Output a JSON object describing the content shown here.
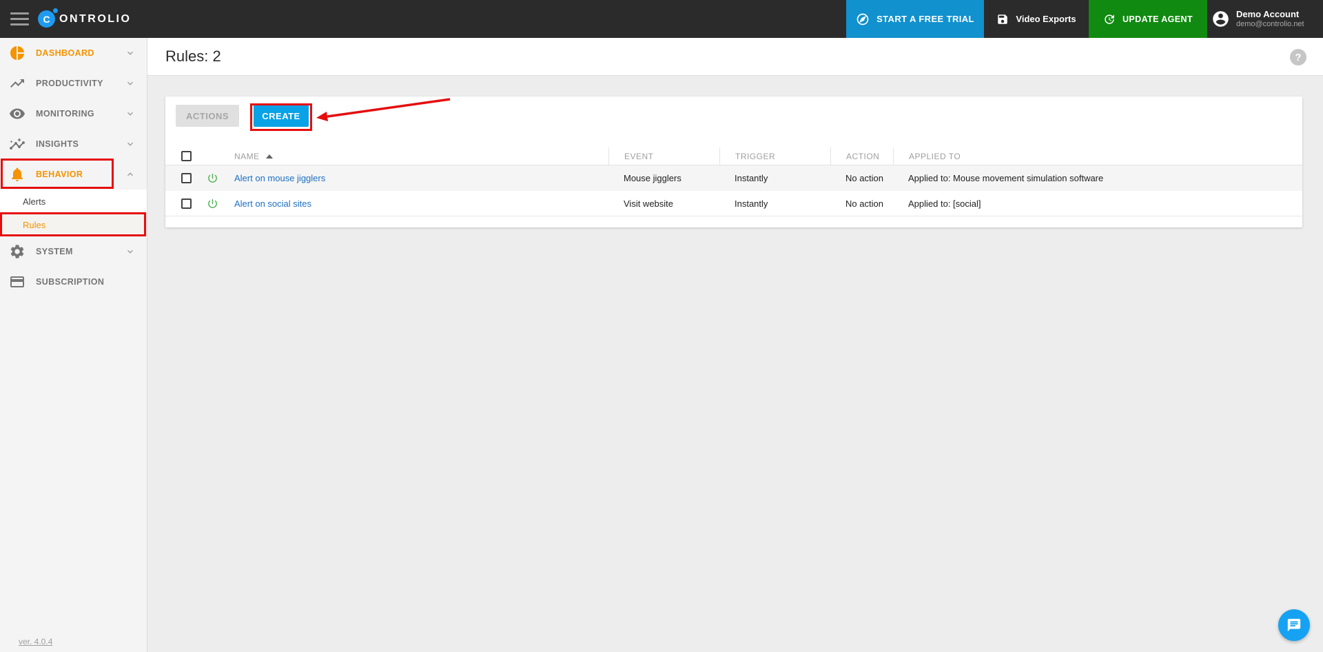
{
  "topbar": {
    "logo_letter": "C",
    "logo_text": "ONTROLIO",
    "trial_label": "START A FREE TRIAL",
    "video_exports_label": "Video Exports",
    "update_agent_label": "UPDATE AGENT",
    "account_name": "Demo Account",
    "account_email": "demo@controlio.net"
  },
  "sidebar": {
    "items": [
      {
        "label": "DASHBOARD"
      },
      {
        "label": "PRODUCTIVITY"
      },
      {
        "label": "MONITORING"
      },
      {
        "label": "INSIGHTS"
      },
      {
        "label": "BEHAVIOR"
      },
      {
        "label": "SYSTEM"
      },
      {
        "label": "SUBSCRIPTION"
      }
    ],
    "behavior_sub_items": [
      {
        "label": "Alerts"
      },
      {
        "label": "Rules"
      }
    ],
    "version_label": "ver. 4.0.4"
  },
  "page": {
    "title": "Rules: 2",
    "help_glyph": "?"
  },
  "toolbar": {
    "actions_label": "ACTIONS",
    "create_label": "CREATE"
  },
  "table": {
    "headers": {
      "name": "NAME",
      "event": "EVENT",
      "trigger": "TRIGGER",
      "action": "ACTION",
      "applied": "APPLIED TO"
    },
    "rows": [
      {
        "name": "Alert on mouse jigglers",
        "event": "Mouse jigglers",
        "trigger": "Instantly",
        "action": "No action",
        "applied": "Applied to: Mouse movement simulation software"
      },
      {
        "name": "Alert on social sites",
        "event": "Visit website",
        "trigger": "Instantly",
        "action": "No action",
        "applied": "Applied to: [social]"
      }
    ]
  },
  "colors": {
    "topbar_bg": "#2b2b2b",
    "trial_blue": "#1191cd",
    "agent_green": "#118a11",
    "create_blue": "#0aa2e6",
    "accent_orange": "#f59300",
    "link_blue": "#1d6fc2",
    "power_green": "#4caf50",
    "annotation_red": "#e60d0d",
    "chat_blue": "#16a2f2"
  }
}
